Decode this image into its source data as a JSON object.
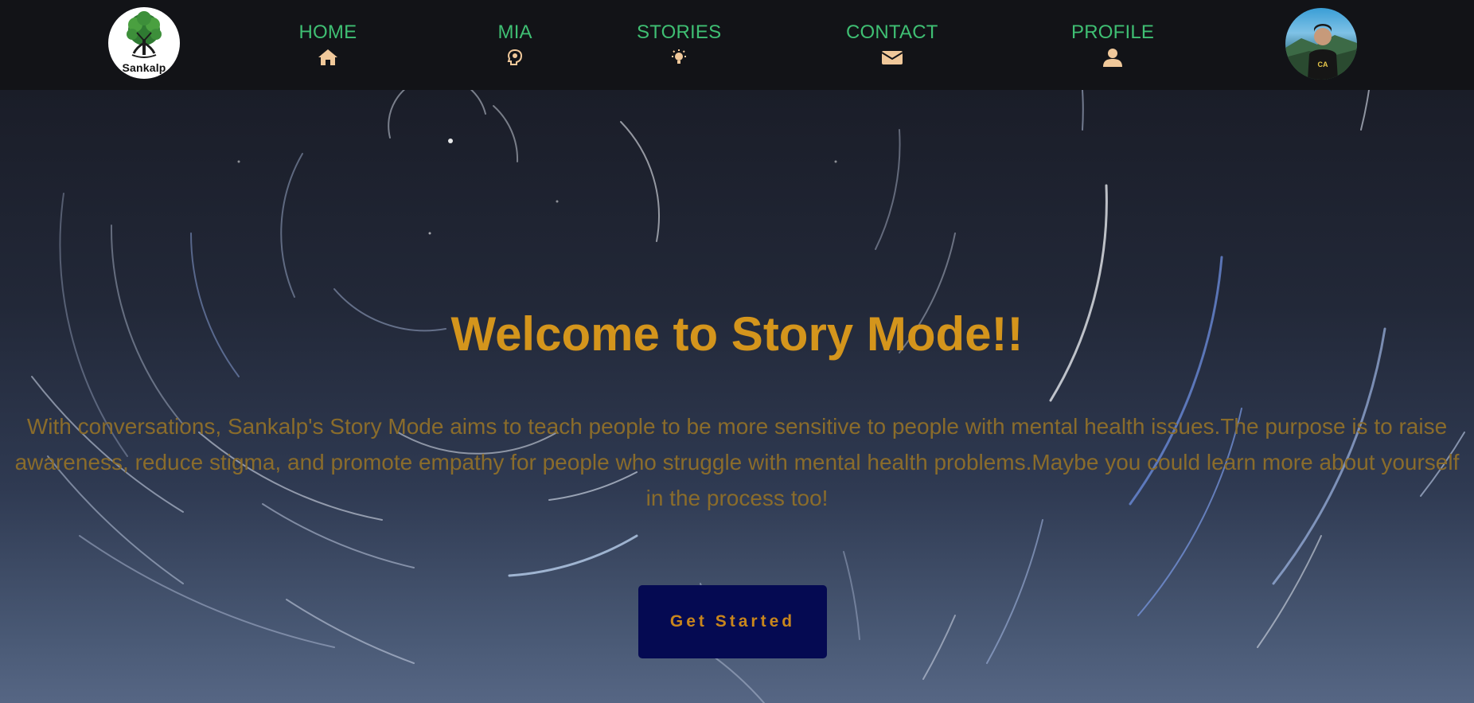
{
  "brand": {
    "name": "Sankalp",
    "logo_icon": "tree-icon"
  },
  "nav": {
    "items": [
      {
        "label": "HOME",
        "icon": "home-icon"
      },
      {
        "label": "MIA",
        "icon": "head-bulb-icon"
      },
      {
        "label": "STORIES",
        "icon": "lightbulb-icon"
      },
      {
        "label": "CONTACT",
        "icon": "envelope-icon"
      },
      {
        "label": "PROFILE",
        "icon": "user-icon"
      }
    ],
    "avatar_icon": "profile-avatar"
  },
  "hero": {
    "title": "Welcome to Story Mode!!",
    "description": "With conversations, Sankalp's Story Mode aims to teach people to be more sensitive to people with mental health issues.The purpose is to raise awareness, reduce stigma, and promote empathy for people who struggle with mental health problems.Maybe you could learn more about yourself in the process too!",
    "cta_label": "Get Started"
  },
  "colors": {
    "nav_bg": "#121317",
    "nav_text": "#3fbf73",
    "nav_icon": "#f0c89a",
    "title": "#d4951c",
    "body_text": "#8a6c2b",
    "button_bg": "#050a52",
    "button_text": "#c9861c"
  }
}
